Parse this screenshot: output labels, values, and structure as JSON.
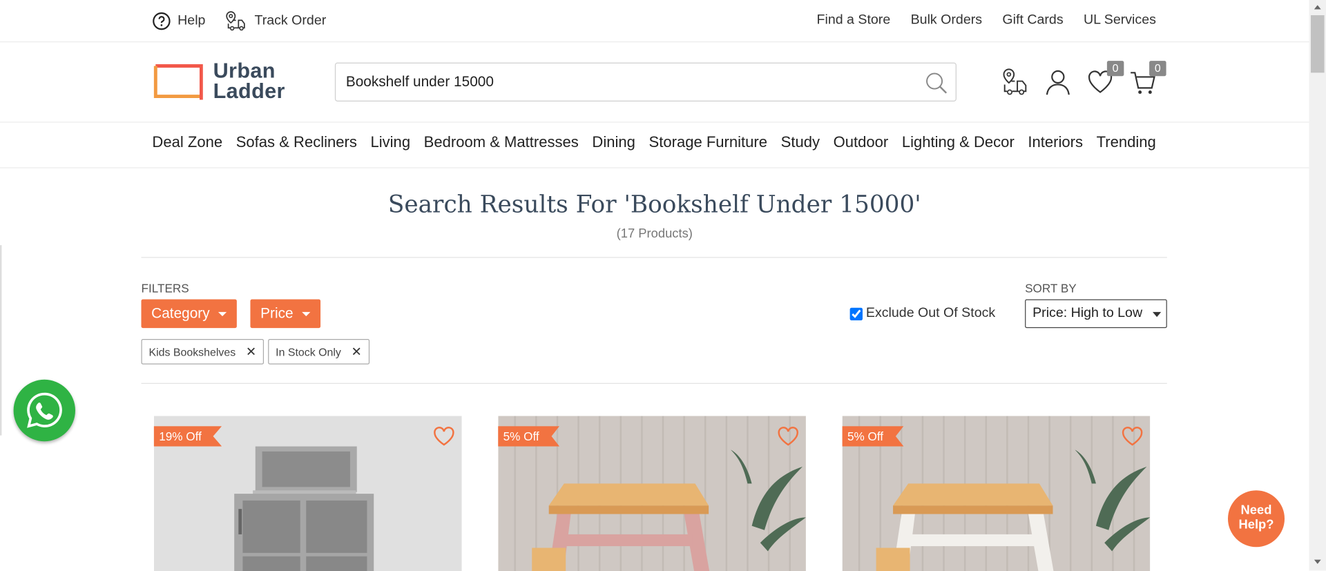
{
  "topbar": {
    "help": "Help",
    "track_order": "Track Order",
    "links": [
      "Find a Store",
      "Bulk Orders",
      "Gift Cards",
      "UL Services"
    ]
  },
  "header": {
    "logo_line1": "Urban",
    "logo_line2": "Ladder",
    "search_value": "Bookshelf under 15000",
    "wishlist_count": "0",
    "cart_count": "0"
  },
  "nav": [
    "Deal Zone",
    "Sofas & Recliners",
    "Living",
    "Bedroom & Mattresses",
    "Dining",
    "Storage Furniture",
    "Study",
    "Outdoor",
    "Lighting & Decor",
    "Interiors",
    "Trending"
  ],
  "results": {
    "title": "Search Results For 'Bookshelf Under 15000'",
    "count": "(17 Products)"
  },
  "filters": {
    "label": "FILTERS",
    "category": "Category",
    "price": "Price",
    "chips": [
      "Kids Bookshelves",
      "In Stock Only"
    ],
    "chip_remove": "✕",
    "exclude_oos": "Exclude Out Of Stock",
    "exclude_oos_checked": true,
    "sort_label": "SORT BY",
    "sort_value": "Price: High to Low"
  },
  "products": [
    {
      "discount": "19% Off"
    },
    {
      "discount": "5% Off"
    },
    {
      "discount": "5% Off"
    }
  ],
  "help_bubble": {
    "line1": "Need",
    "line2": "Help?"
  },
  "colors": {
    "accent": "#f27341",
    "navy": "#3a4a5c",
    "whatsapp": "#2fb344"
  }
}
